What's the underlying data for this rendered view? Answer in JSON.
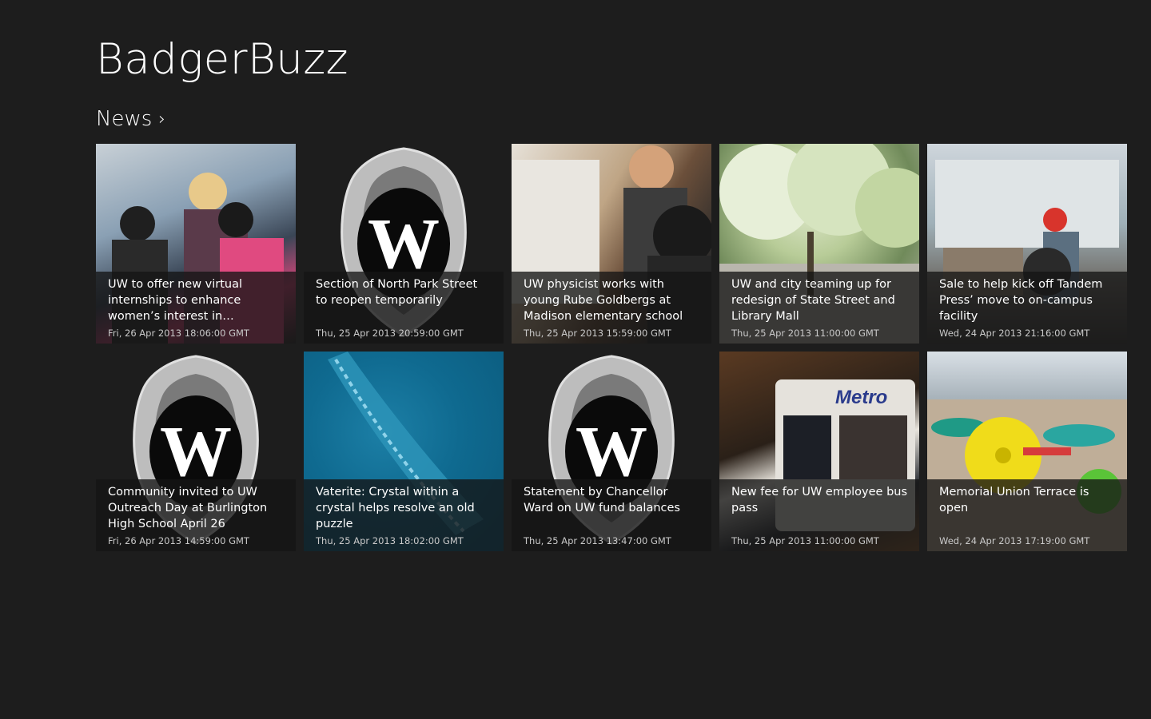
{
  "app": {
    "title": "BadgerBuzz"
  },
  "section": {
    "label": "News",
    "chevron": "›"
  },
  "tiles": [
    {
      "headline": "UW to offer new virtual internships to enhance women’s interest in engineering",
      "date": "Fri, 26 Apr 2013 18:06:00 GMT",
      "image": "students-at-computer-photo"
    },
    {
      "headline": "Section of North Park Street to reopen temporarily",
      "date": "Thu, 25 Apr 2013 20:59:00 GMT",
      "image": "uw-crest-logo"
    },
    {
      "headline": "UW physicist works with young Rube Goldbergs at Madison elementary school",
      "date": "Thu, 25 Apr 2013 15:59:00 GMT",
      "image": "physicist-with-child-photo"
    },
    {
      "headline": "UW and city teaming up for redesign of State Street and Library Mall",
      "date": "Thu, 25 Apr 2013 11:00:00 GMT",
      "image": "library-mall-trees-photo"
    },
    {
      "headline": "Sale to help kick off Tandem Press’ move to on-campus facility",
      "date": "Wed, 24 Apr 2013 21:16:00 GMT",
      "image": "press-workshop-photo"
    },
    {
      "headline": "Community invited to UW Outreach Day at Burlington High School April 26",
      "date": "Fri, 26 Apr 2013 14:59:00 GMT",
      "image": "uw-crest-logo"
    },
    {
      "headline": "Vaterite: Crystal within a crystal helps resolve an old puzzle",
      "date": "Thu, 25 Apr 2013 18:02:00 GMT",
      "image": "crystal-micrograph-photo"
    },
    {
      "headline": "Statement by Chancellor Ward on UW fund balances",
      "date": "Thu, 25 Apr 2013 13:47:00 GMT",
      "image": "uw-crest-logo"
    },
    {
      "headline": "New fee for UW employee bus pass",
      "date": "Thu, 25 Apr 2013 11:00:00 GMT",
      "image": "metro-bus-photo",
      "bus_label": "Metro"
    },
    {
      "headline": "Memorial Union Terrace is open",
      "date": "Wed, 24 Apr 2013 17:19:00 GMT",
      "image": "terrace-chairs-photo"
    }
  ],
  "crest_letter": "W"
}
